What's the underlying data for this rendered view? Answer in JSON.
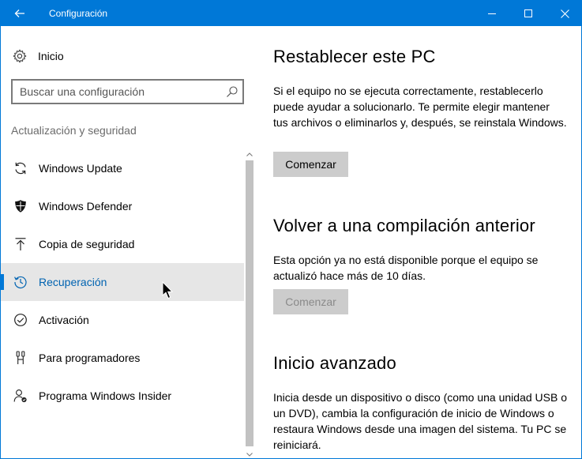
{
  "titlebar": {
    "title": "Configuración",
    "back_icon": "back-arrow-icon",
    "controls": [
      "minimize-icon",
      "maximize-icon",
      "close-icon"
    ],
    "color": "#0078d7"
  },
  "sidebar": {
    "home_label": "Inicio",
    "search_placeholder": "Buscar una configuración",
    "section_label": "Actualización y seguridad",
    "items": [
      {
        "label": "Windows Update",
        "icon": "sync-icon",
        "selected": false
      },
      {
        "label": "Windows Defender",
        "icon": "shield-icon",
        "selected": false
      },
      {
        "label": "Copia de seguridad",
        "icon": "upload-arrow-icon",
        "selected": false
      },
      {
        "label": "Recuperación",
        "icon": "history-icon",
        "selected": true
      },
      {
        "label": "Activación",
        "icon": "check-circle-icon",
        "selected": false
      },
      {
        "label": "Para programadores",
        "icon": "developer-tools-icon",
        "selected": false
      },
      {
        "label": "Programa Windows Insider",
        "icon": "insider-person-icon",
        "selected": false
      }
    ],
    "accent": "#0078d7"
  },
  "content": {
    "sections": [
      {
        "title": "Restablecer este PC",
        "text": "Si el equipo no se ejecuta correctamente, restablecerlo puede ayudar a solucionarlo. Te permite elegir mantener tus archivos o eliminarlos y, después, se reinstala Windows.",
        "button": "Comenzar",
        "button_enabled": true
      },
      {
        "title": "Volver a una compilación anterior",
        "text": "Esta opción ya no está disponible porque el equipo se actualizó hace más de 10 días.",
        "button": "Comenzar",
        "button_enabled": false
      },
      {
        "title": "Inicio avanzado",
        "text": "Inicia desde un dispositivo o disco (como una unidad USB o un DVD), cambia la configuración de inicio de Windows o restaura Windows desde una imagen del sistema. Tu PC se reiniciará."
      }
    ]
  }
}
